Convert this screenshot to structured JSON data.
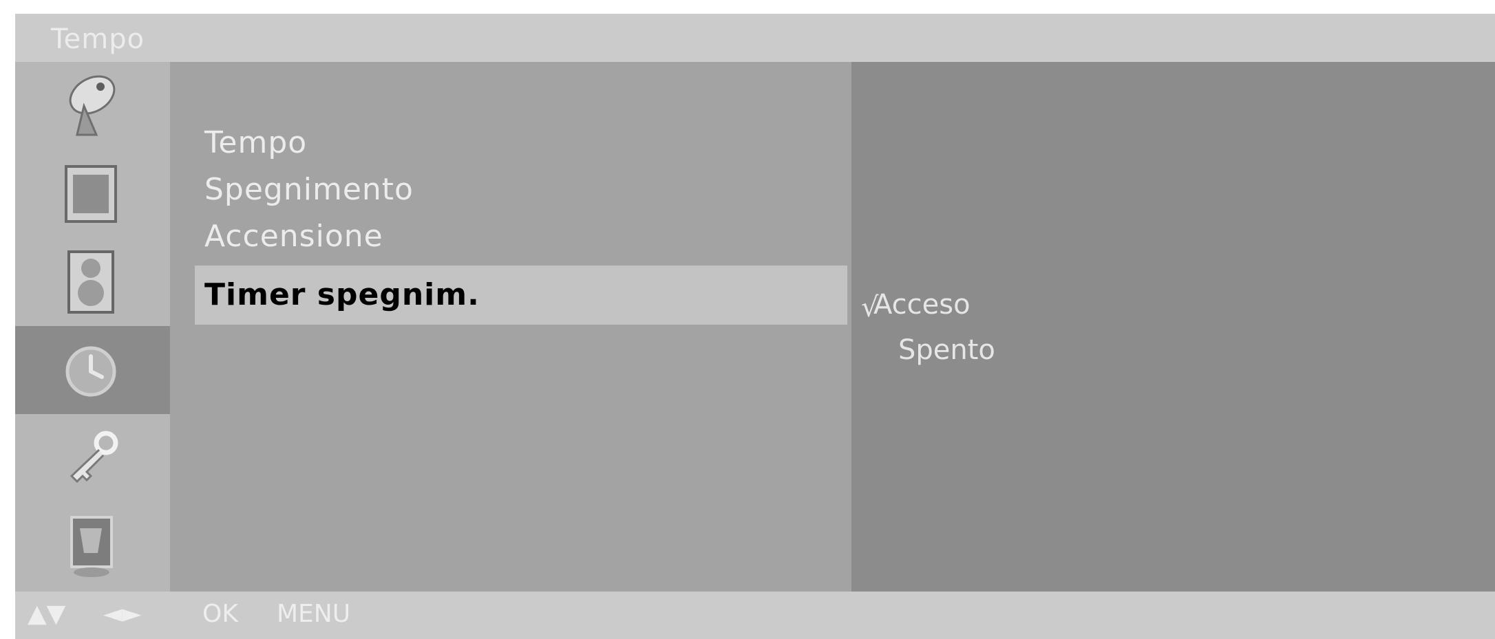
{
  "header": {
    "title": "Tempo"
  },
  "sidebar": {
    "icons": [
      {
        "name": "satellite-dish-icon",
        "selected": false
      },
      {
        "name": "picture-icon",
        "selected": false
      },
      {
        "name": "speaker-icon",
        "selected": false
      },
      {
        "name": "clock-icon",
        "selected": true
      },
      {
        "name": "key-icon",
        "selected": false
      },
      {
        "name": "special-icon",
        "selected": false
      }
    ]
  },
  "menu": {
    "items": [
      {
        "label": "Tempo",
        "highlighted": false
      },
      {
        "label": "Spegnimento",
        "highlighted": false
      },
      {
        "label": "Accensione",
        "highlighted": false
      },
      {
        "label": "Timer spegnim.",
        "highlighted": true
      }
    ]
  },
  "options": {
    "check_glyph": "√",
    "items": [
      {
        "label": "Acceso",
        "checked": true
      },
      {
        "label": "Spento",
        "checked": false
      }
    ]
  },
  "footer": {
    "nav_updown": "▲▼",
    "nav_leftright": "◄►",
    "ok": "OK",
    "menu": "MENU"
  },
  "colors": {
    "title_bar": "#cbcbcb",
    "icon_column": "#b7b7b7",
    "menu_background": "#a3a3a3",
    "options_background": "#8c8c8c",
    "highlight": "#c3c3c3",
    "text_light": "#ececec",
    "text_highlight": "#000000"
  }
}
